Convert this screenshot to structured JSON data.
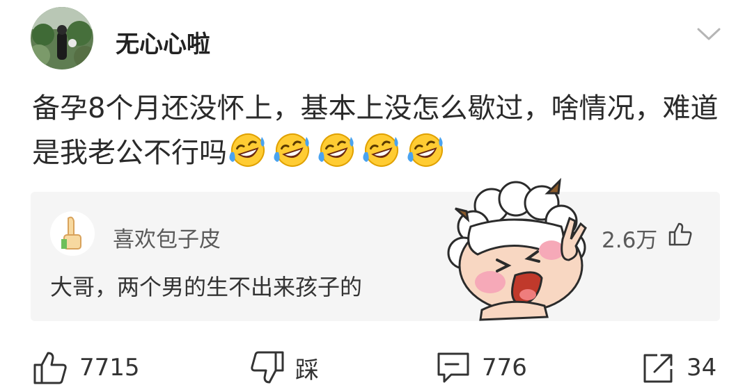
{
  "post": {
    "username": "无心心啦",
    "text": "备孕8个月还没怀上，基本上没怎么歇过，啥情况，难道是我老公不行吗",
    "emoji_icon": "rolling-laughing-emoji",
    "emoji_count": 5
  },
  "top_comment": {
    "username": "喜欢包子皮",
    "text": "大哥，两个男的生不出来孩子的",
    "likes": "2.6万"
  },
  "actions": {
    "like_count": "7715",
    "dislike_label": "踩",
    "comment_count": "776",
    "share_count": "34"
  },
  "colors": {
    "background": "#ffffff",
    "card_background": "#f5f5f5",
    "text": "#222222",
    "secondary_text": "#5a5a5a"
  }
}
